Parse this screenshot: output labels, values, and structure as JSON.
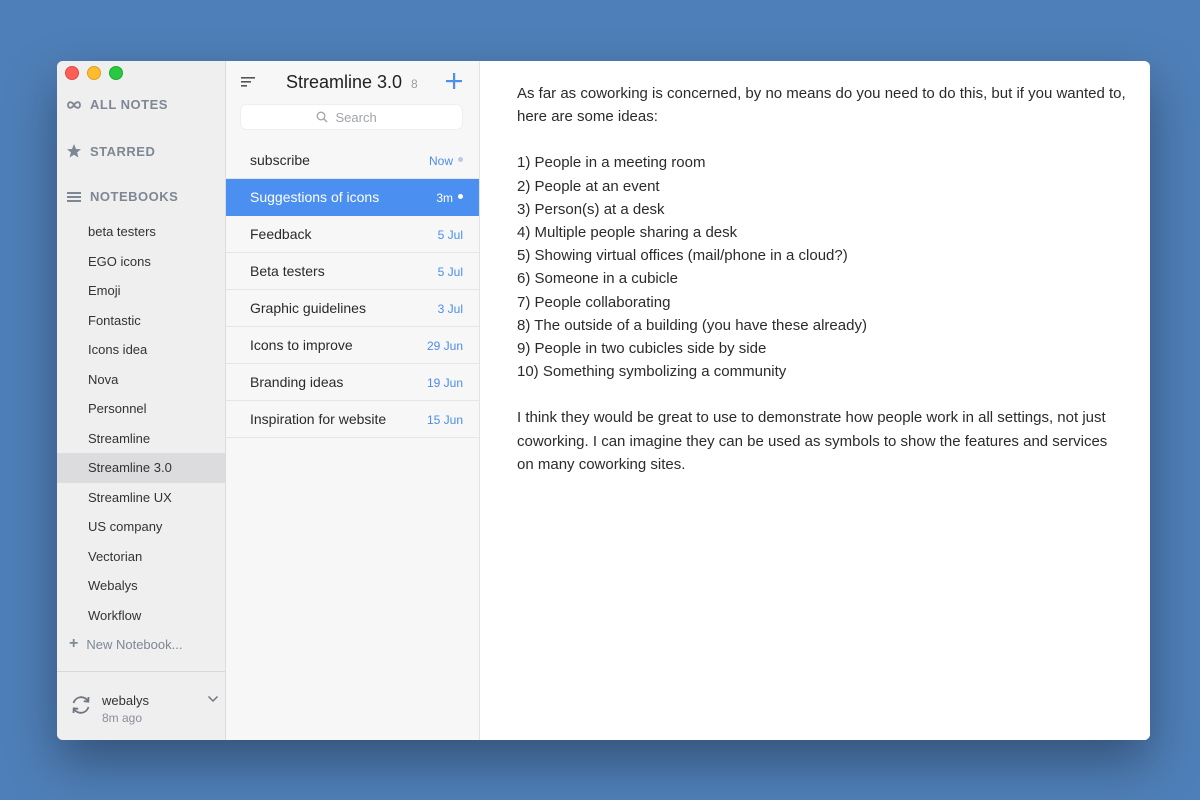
{
  "sidebar": {
    "all_notes": "ALL NOTES",
    "starred": "STARRED",
    "notebooks": "NOTEBOOKS",
    "notebook_items": [
      "beta testers",
      "EGO icons",
      "Emoji",
      "Fontastic",
      "Icons idea",
      "Nova",
      "Personnel",
      "Streamline",
      "Streamline 3.0",
      "Streamline UX",
      "US company",
      "Vectorian",
      "Webalys",
      "Workflow"
    ],
    "selected_notebook": "Streamline 3.0",
    "new_notebook": "New Notebook...",
    "account": {
      "name": "webalys",
      "synced": "8m ago"
    }
  },
  "notelist": {
    "title": "Streamline 3.0",
    "count": "8",
    "search_placeholder": "Search",
    "notes": [
      {
        "title": "subscribe",
        "date": "Now",
        "dot": true
      },
      {
        "title": "Suggestions of icons",
        "date": "3m",
        "dot": true,
        "selected": true
      },
      {
        "title": "Feedback",
        "date": "5 Jul"
      },
      {
        "title": "Beta testers",
        "date": "5 Jul"
      },
      {
        "title": "Graphic guidelines",
        "date": "3 Jul"
      },
      {
        "title": "Icons to improve",
        "date": "29 Jun"
      },
      {
        "title": "Branding ideas",
        "date": "19 Jun"
      },
      {
        "title": "Inspiration for website",
        "date": "15 Jun"
      }
    ]
  },
  "editor": {
    "intro": "As far as coworking is concerned, by no means do you need to do this, but if you wanted to, here are some ideas:",
    "list": [
      "1) People in a meeting room",
      "2) People at an event",
      "3) Person(s) at a desk",
      "4) Multiple people sharing a desk",
      "5) Showing virtual offices (mail/phone in a cloud?)",
      "6) Someone in a cubicle",
      "7) People collaborating",
      "8) The outside of a building (you have these already)",
      "9) People in two cubicles side by side",
      "10) Something symbolizing a community"
    ],
    "closing": "I think they would be great to use to demonstrate how people work in all settings, not just coworking. I can imagine they can be used as symbols to show the features and services on many coworking sites."
  },
  "colors": {
    "background": "#4f7fb8",
    "accent": "#4b8ff0",
    "sidebar": "#efeff0",
    "notelist": "#f7f7f8"
  }
}
